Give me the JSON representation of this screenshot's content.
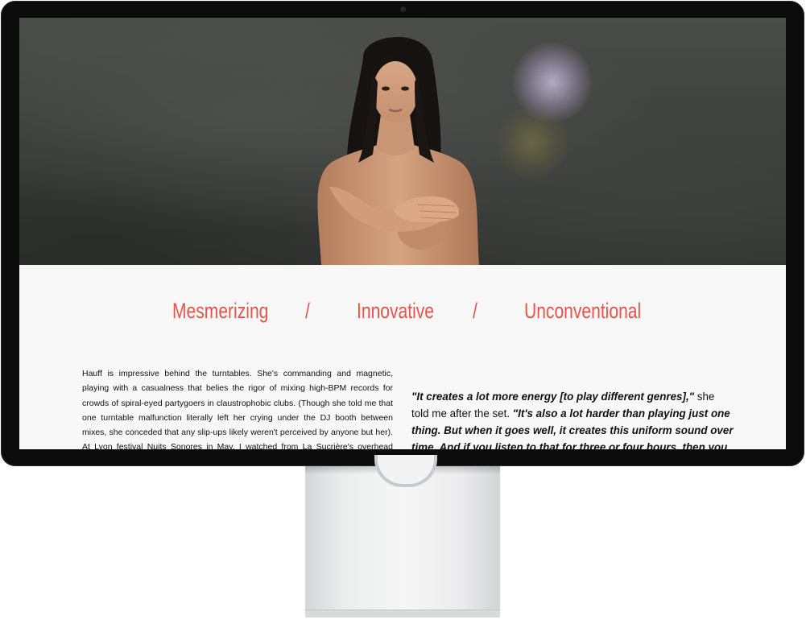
{
  "hero": {
    "image": "woman-portrait-photo"
  },
  "headline": {
    "word1": "Mesmerizing",
    "sep1": "/",
    "word2": "Innovative",
    "sep2": "/",
    "word3": "Unconventional",
    "color": "#e9534a"
  },
  "article": {
    "left_paragraph": "Hauff is impressive behind the turntables. She's commanding and magnetic, playing with a casualness that belies the rigor of mixing high-BPM records for crowds of spiral-eyed partygoers in claustrophobic clubs. (Though she told me that one turntable malfunction literally left her crying under the DJ booth between mixes, she conceded that any slip-ups likely weren't perceived by anyone but her). At Lyon festival Nuits Sonores in May, I watched from La Sucrière's overhead mezzanine as she lissomely",
    "quote_1": "\"It creates a lot more energy [to play different genres],\"",
    "quote_1_tail": " she told me after the set. ",
    "quote_2": "\"It's also a lot harder than playing just one thing. But when it goes well, it creates this uniform sound over time. And if you listen to that for three or four hours, then you can"
  }
}
